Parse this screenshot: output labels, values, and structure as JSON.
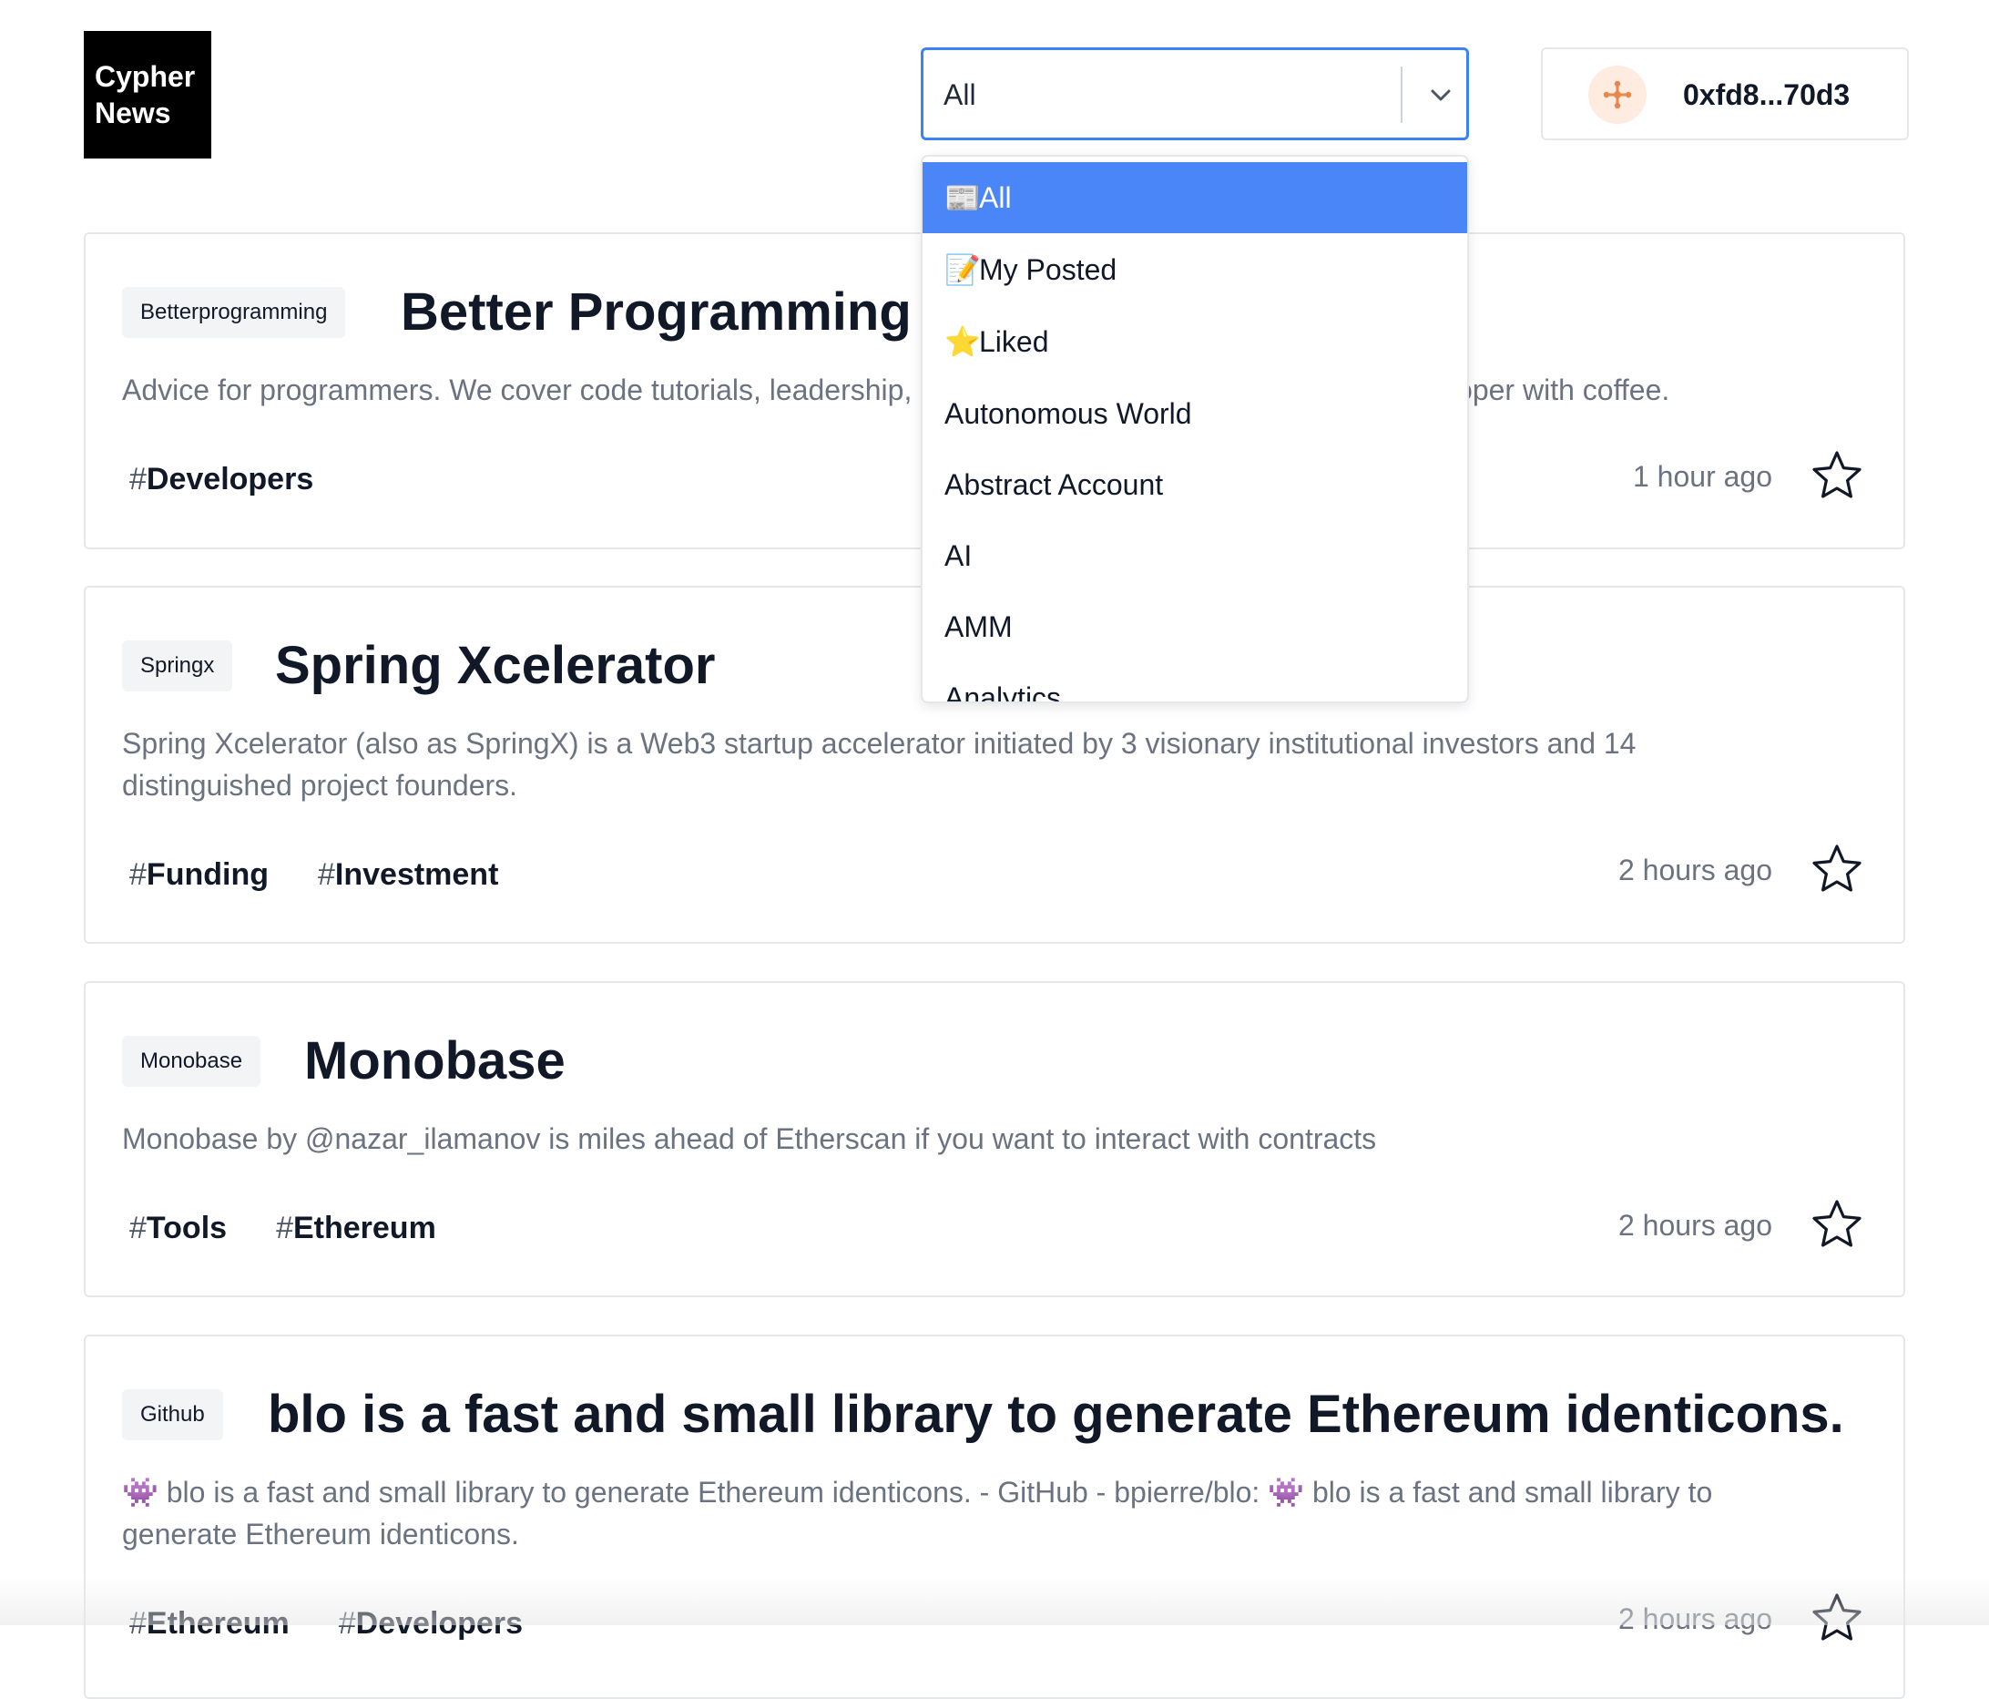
{
  "logo": {
    "line1": "Cypher",
    "line2": "News"
  },
  "filter": {
    "selected": "All",
    "options": [
      {
        "icon": "📰",
        "label": "All"
      },
      {
        "icon": "📝",
        "label": "My Posted"
      },
      {
        "icon": "⭐",
        "label": "Liked"
      },
      {
        "icon": "",
        "label": "Autonomous World"
      },
      {
        "icon": "",
        "label": "Abstract Account"
      },
      {
        "icon": "",
        "label": "AI"
      },
      {
        "icon": "",
        "label": "AMM"
      },
      {
        "icon": "",
        "label": "Analytics"
      }
    ]
  },
  "wallet": {
    "address": "0xfd8...70d3"
  },
  "cards": [
    {
      "source": "Betterprogramming",
      "title": "Better Programming",
      "description": "Advice for programmers. We cover code tutorials, leadership, career, and how to become a better developer with coffee.",
      "tags": [
        {
          "hash": "#",
          "label": "Developers"
        }
      ],
      "time": "1 hour ago"
    },
    {
      "source": "Springx",
      "title": "Spring Xcelerator",
      "description": "Spring Xcelerator (also as SpringX) is a Web3 startup accelerator initiated by 3 visionary institutional investors and 14 distinguished project founders.",
      "tags": [
        {
          "hash": "#",
          "label": "Funding"
        },
        {
          "hash": "#",
          "label": "Investment"
        }
      ],
      "time": "2 hours ago"
    },
    {
      "source": "Monobase",
      "title": "Monobase",
      "description": "Monobase by @nazar_ilamanov is miles ahead of Etherscan if you want to interact with contracts",
      "tags": [
        {
          "hash": "#",
          "label": "Tools"
        },
        {
          "hash": "#",
          "label": "Ethereum"
        }
      ],
      "time": "2 hours ago"
    },
    {
      "source": "Github",
      "title": "blo is a fast and small library to generate Ethereum identicons.",
      "description": "👾 blo is a fast and small library to generate Ethereum identicons. - GitHub - bpierre/blo: 👾 blo is a fast and small library to generate Ethereum identicons.",
      "tags": [
        {
          "hash": "#",
          "label": "Ethereum"
        },
        {
          "hash": "#",
          "label": "Developers"
        }
      ],
      "time": "2 hours ago"
    }
  ],
  "colors": {
    "accent": "#3b82f6",
    "selected_option_bg": "#4a86f7",
    "wallet_icon": "#e8874b"
  },
  "icons": [
    "chevron-down-icon",
    "wallet-avatar-icon",
    "star-icon"
  ]
}
